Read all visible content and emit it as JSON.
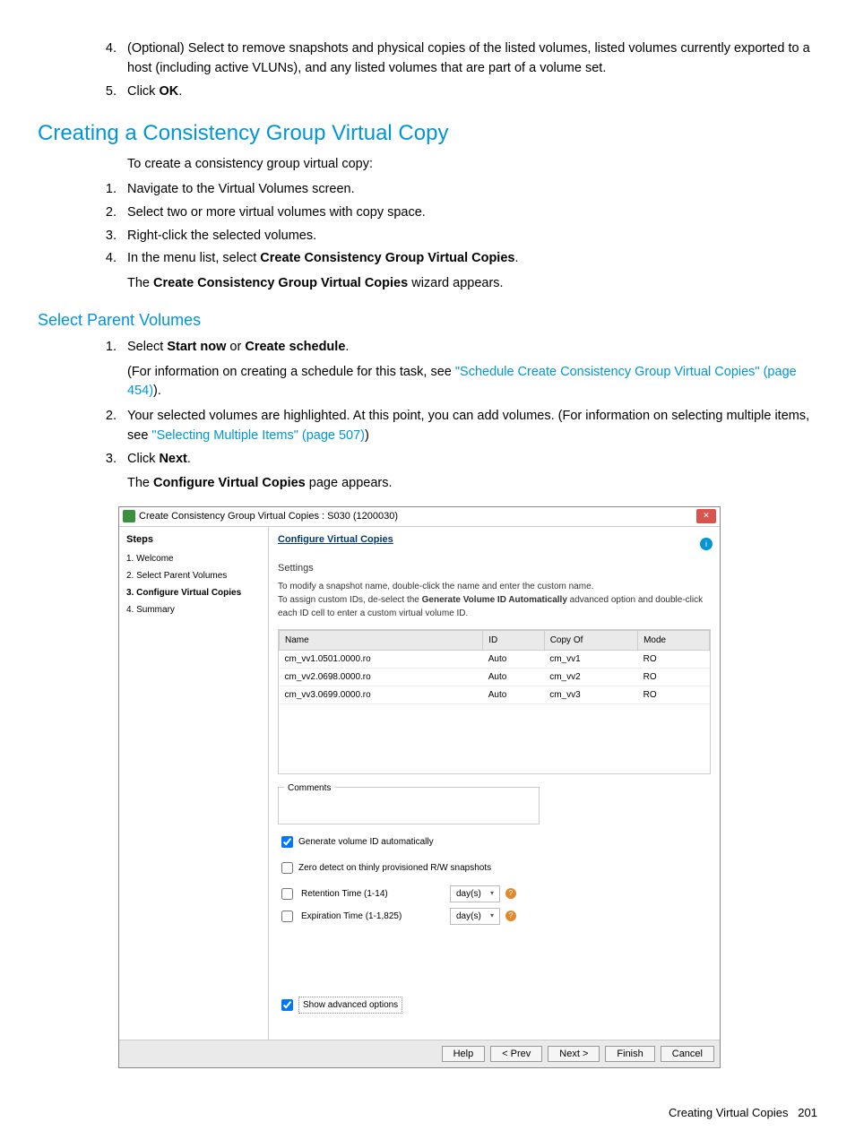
{
  "steps4_5": [
    {
      "n": "4.",
      "text_prefix": "(Optional) Select to remove snapshots and physical copies of the listed volumes, listed volumes currently exported to a host (including active VLUNs), and any listed volumes that are part of a volume set."
    },
    {
      "n": "5.",
      "text_prefix": "Click ",
      "bold": "OK",
      "text_suffix": "."
    }
  ],
  "section_h2": "Creating a Consistency Group Virtual Copy",
  "intro_p": "To create a consistency group virtual copy:",
  "steps_main": [
    {
      "n": "1.",
      "text": "Navigate to the Virtual Volumes screen."
    },
    {
      "n": "2.",
      "text": "Select two or more virtual volumes with copy space."
    },
    {
      "n": "3.",
      "text": "Right-click the selected volumes."
    },
    {
      "n": "4.",
      "text_a": "In the menu list, select ",
      "bold_a": "Create Consistency Group Virtual Copies",
      "text_b": ".",
      "sub_a": "The ",
      "sub_bold": "Create Consistency Group Virtual Copies",
      "sub_b": " wizard appears."
    }
  ],
  "sub_h3": "Select Parent Volumes",
  "spv": [
    {
      "n": "1.",
      "a": "Select ",
      "b1": "Start now",
      "mid": " or ",
      "b2": "Create schedule",
      "end": ".",
      "sub_a": "(For information on creating a schedule for this task, see ",
      "link": "\"Schedule Create Consistency Group Virtual Copies\" (page 454)",
      "sub_b": ")."
    },
    {
      "n": "2.",
      "text": "Your selected volumes are highlighted. At this point, you can add volumes. (For information on selecting multiple items, see ",
      "link": "\"Selecting Multiple Items\" (page 507)",
      "end": ")"
    },
    {
      "n": "3.",
      "a": "Click ",
      "b": "Next",
      "end": ".",
      "sub_a": "The ",
      "sub_bold": "Configure Virtual Copies",
      "sub_b": " page appears."
    }
  ],
  "wizard": {
    "title": "Create Consistency Group Virtual Copies : S030 (1200030)",
    "steps_h": "Steps",
    "side": [
      "1. Welcome",
      "2. Select Parent Volumes",
      "3. Configure Virtual Copies",
      "4. Summary"
    ],
    "side_sel_index": 2,
    "main_h": "Configure Virtual Copies",
    "settings_lbl": "Settings",
    "s_text_1": "To modify a snapshot name, double-click the name and enter the custom name.",
    "s_text_2a": "To assign custom IDs, de-select the ",
    "s_text_2b": "Generate Volume ID Automatically",
    "s_text_2c": " advanced option and double-click each ID cell to enter a custom virtual volume ID.",
    "cols": [
      "Name",
      "ID",
      "Copy Of",
      "Mode"
    ],
    "rows": [
      {
        "name": "cm_vv1.0501.0000.ro",
        "id": "Auto",
        "copyof": "cm_vv1",
        "mode": "RO"
      },
      {
        "name": "cm_vv2.0698.0000.ro",
        "id": "Auto",
        "copyof": "cm_vv2",
        "mode": "RO"
      },
      {
        "name": "cm_vv3.0699.0000.ro",
        "id": "Auto",
        "copyof": "cm_vv3",
        "mode": "RO"
      }
    ],
    "comments": "Comments",
    "chk_gen": "Generate volume ID automatically",
    "chk_zero": "Zero detect on thinly provisioned R/W snapshots",
    "chk_ret": "Retention Time  (1-14)",
    "chk_exp": "Expiration Time  (1-1,825)",
    "unit": "day(s)",
    "adv": "Show advanced options",
    "buttons": [
      "Help",
      "< Prev",
      "Next >",
      "Finish",
      "Cancel"
    ]
  },
  "footer_l": "Creating Virtual Copies",
  "footer_p": "201"
}
